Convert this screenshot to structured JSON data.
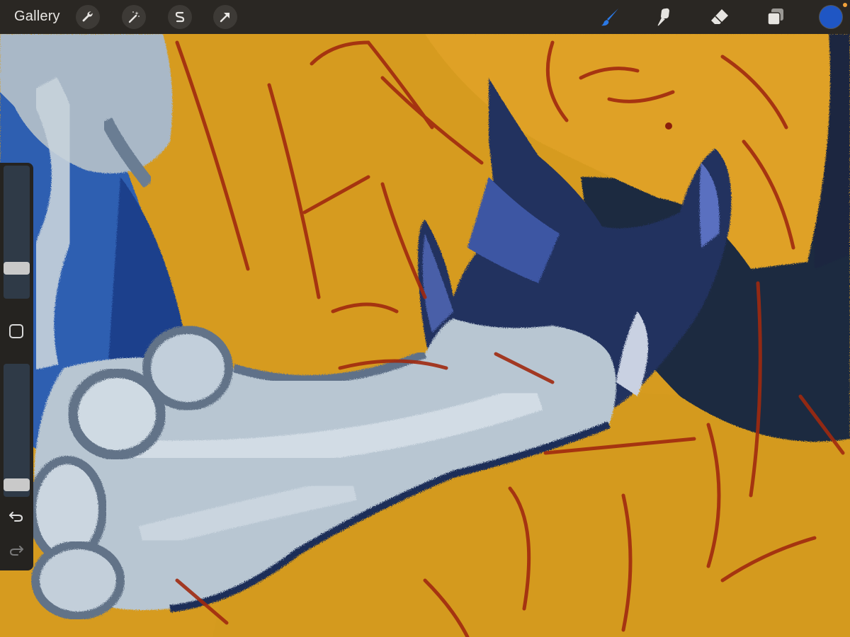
{
  "toolbar": {
    "gallery_label": "Gallery",
    "left_tools": [
      "wrench-icon",
      "magic-wand-icon",
      "selection-icon",
      "transform-arrow-icon"
    ],
    "right_tools": [
      "brush-icon",
      "smudge-icon",
      "eraser-icon",
      "layers-icon"
    ],
    "active_tool": "brush-icon",
    "accent_color": "#2a78e4",
    "current_color": "#1f56c4",
    "notification_color": "#f2a23a"
  },
  "sidebar": {
    "brush_size": 0.2,
    "brush_opacity": 0.05,
    "modify_button_icon": "square-icon",
    "undo_icon": "undo-arrow-icon",
    "redo_icon": "redo-arrow-icon"
  },
  "canvas": {
    "description_colors": {
      "background": "#d79d1e",
      "sketch_lines": "#9e2a12",
      "dark_hand": "#1e2c58",
      "light_arm": "#c3d0da"
    }
  }
}
